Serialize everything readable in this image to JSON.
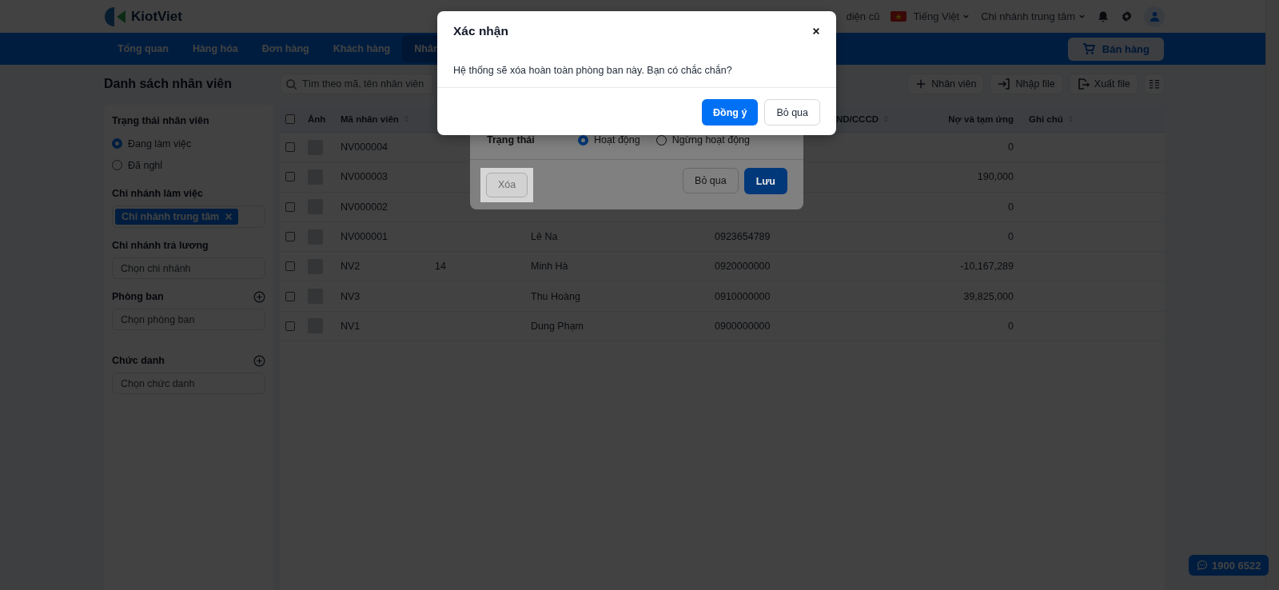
{
  "header": {
    "logo_text": "KiotViet",
    "old_ui_link": "diện cũ",
    "language": "Tiếng Việt",
    "branch": "Chi nhánh trung tâm"
  },
  "nav": {
    "items": [
      {
        "label": "Tổng quan",
        "selected": false
      },
      {
        "label": "Hàng hóa",
        "selected": false
      },
      {
        "label": "Đơn hàng",
        "selected": false
      },
      {
        "label": "Khách hàng",
        "selected": false
      },
      {
        "label": "Nhân",
        "selected": true
      }
    ],
    "sell_button": "Bán hàng"
  },
  "sidebar": {
    "title": "Danh sách nhân viên",
    "sections": [
      {
        "kind": "radio",
        "label": "Trạng thái nhân viên",
        "options": [
          {
            "label": "Đang làm việc",
            "selected": true
          },
          {
            "label": "Đã nghỉ",
            "selected": false
          }
        ]
      },
      {
        "kind": "tags",
        "label": "Chi nhánh làm việc",
        "tags": [
          "Chi nhánh trung tâm"
        ]
      },
      {
        "kind": "select",
        "label": "Chi nhánh trả lương",
        "placeholder": "Chọn chi nhánh",
        "addable": false
      },
      {
        "kind": "select",
        "label": "Phòng ban",
        "placeholder": "Chọn phòng ban",
        "addable": true
      },
      {
        "kind": "select",
        "label": "Chức danh",
        "placeholder": "Chọn chức danh",
        "addable": true
      }
    ]
  },
  "toolbar": {
    "search_placeholder": "Tìm theo mã, tên nhân viên",
    "buttons": [
      {
        "label": "Nhân viên",
        "kind": "add"
      },
      {
        "label": "Nhập file",
        "kind": "import"
      },
      {
        "label": "Xuất file",
        "kind": "export"
      }
    ]
  },
  "table": {
    "select_all_checked": false,
    "columns": [
      {
        "label": "Ảnh",
        "sortable": false
      },
      {
        "label": "Mã nhân viên",
        "sortable": true
      },
      {
        "label": "ND/CCCD",
        "sortable": true
      },
      {
        "label": "Nợ và tạm ứng",
        "sortable": false
      },
      {
        "label": "Ghi chú",
        "sortable": true
      }
    ],
    "rows": [
      {
        "checked": false,
        "code": "NV000004",
        "debt": "0"
      },
      {
        "checked": false,
        "code": "NV000003",
        "debt": "190,000"
      },
      {
        "checked": false,
        "code": "NV000002",
        "debt": "0"
      },
      {
        "checked": false,
        "code": "NV000001",
        "name": "Lê Na",
        "phone": "0923654789",
        "debt": "0"
      },
      {
        "checked": false,
        "code": "NV2",
        "column_3": "14",
        "name": "Minh Hà",
        "phone": "0920000000",
        "debt": "-10,167,289"
      },
      {
        "checked": false,
        "code": "NV3",
        "name": "Thu Hoàng",
        "phone": "0910000000",
        "debt": "39,825,000"
      },
      {
        "checked": false,
        "code": "NV1",
        "name": "Dung Phạm",
        "phone": "0900000000",
        "debt": "0"
      }
    ]
  },
  "dialog": {
    "fields": [
      {
        "label": "Trạng thái",
        "options": [
          {
            "label": "Hoạt động",
            "selected": true
          },
          {
            "label": "Ngừng hoạt động",
            "selected": false
          }
        ]
      }
    ],
    "buttons": [
      {
        "label": "Xóa",
        "kind": "delete",
        "highlighted": true
      },
      {
        "label": "Bỏ qua",
        "kind": "secondary",
        "highlighted": false
      },
      {
        "label": "Lưu",
        "kind": "primary",
        "highlighted": false
      }
    ]
  },
  "confirm": {
    "title": "Xác nhận",
    "message": "Hệ thống sẽ xóa hoàn toàn phòng ban này. Bạn có chắc chắn?",
    "buttons": [
      {
        "label": "Đồng ý",
        "kind": "primary"
      },
      {
        "label": "Bỏ qua",
        "kind": "secondary"
      }
    ]
  },
  "support_button": "1900 6522"
}
